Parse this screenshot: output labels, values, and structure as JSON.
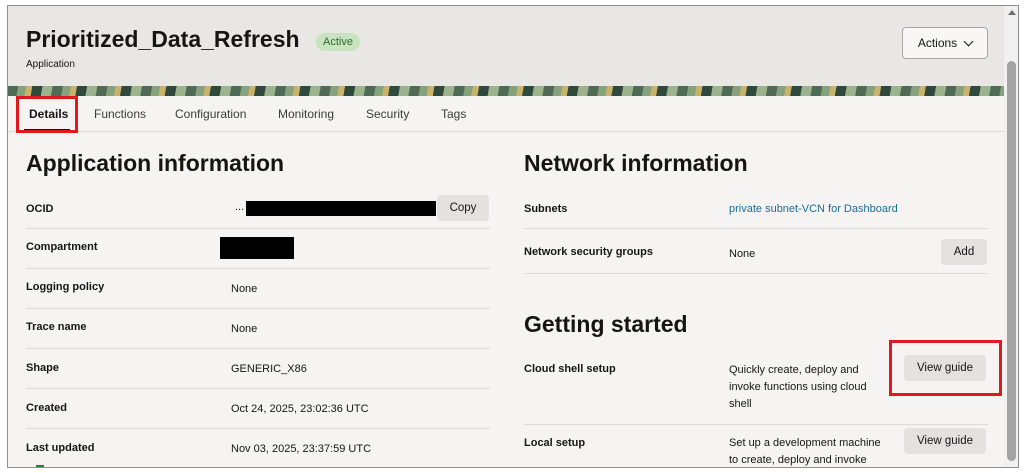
{
  "header": {
    "title": "Prioritized_Data_Refresh",
    "status_badge": "Active",
    "subtitle": "Application",
    "actions_label": "Actions"
  },
  "tabs": [
    {
      "label": "Details",
      "active": true
    },
    {
      "label": "Functions"
    },
    {
      "label": "Configuration"
    },
    {
      "label": "Monitoring"
    },
    {
      "label": "Security"
    },
    {
      "label": "Tags"
    }
  ],
  "app_info": {
    "heading": "Application information",
    "ocid_label": "OCID",
    "ocid_prefix": "...",
    "copy_label": "Copy",
    "compartment_label": "Compartment",
    "logging_policy_label": "Logging policy",
    "logging_policy_value": "None",
    "trace_name_label": "Trace name",
    "trace_name_value": "None",
    "shape_label": "Shape",
    "shape_value": "GENERIC_X86",
    "created_label": "Created",
    "created_value": "Oct 24, 2025, 23:02:36 UTC",
    "last_updated_label": "Last updated",
    "last_updated_value": "Nov 03, 2025, 23:37:59 UTC"
  },
  "network_info": {
    "heading": "Network information",
    "subnets_label": "Subnets",
    "subnets_value": "private subnet-VCN for Dashboard",
    "nsg_label": "Network security groups",
    "nsg_value": "None",
    "add_label": "Add"
  },
  "getting_started": {
    "heading": "Getting started",
    "cloud_shell_label": "Cloud shell setup",
    "cloud_shell_desc": "Quickly create, deploy and invoke functions using cloud shell",
    "cloud_shell_button": "View guide",
    "local_setup_label": "Local setup",
    "local_setup_desc": "Set up a development machine to create, deploy and invoke",
    "local_setup_button": "View guide"
  },
  "colors": {
    "highlight_box": "#e0191f",
    "badge_bg": "#c7e3bf",
    "link": "#1a6d92"
  }
}
